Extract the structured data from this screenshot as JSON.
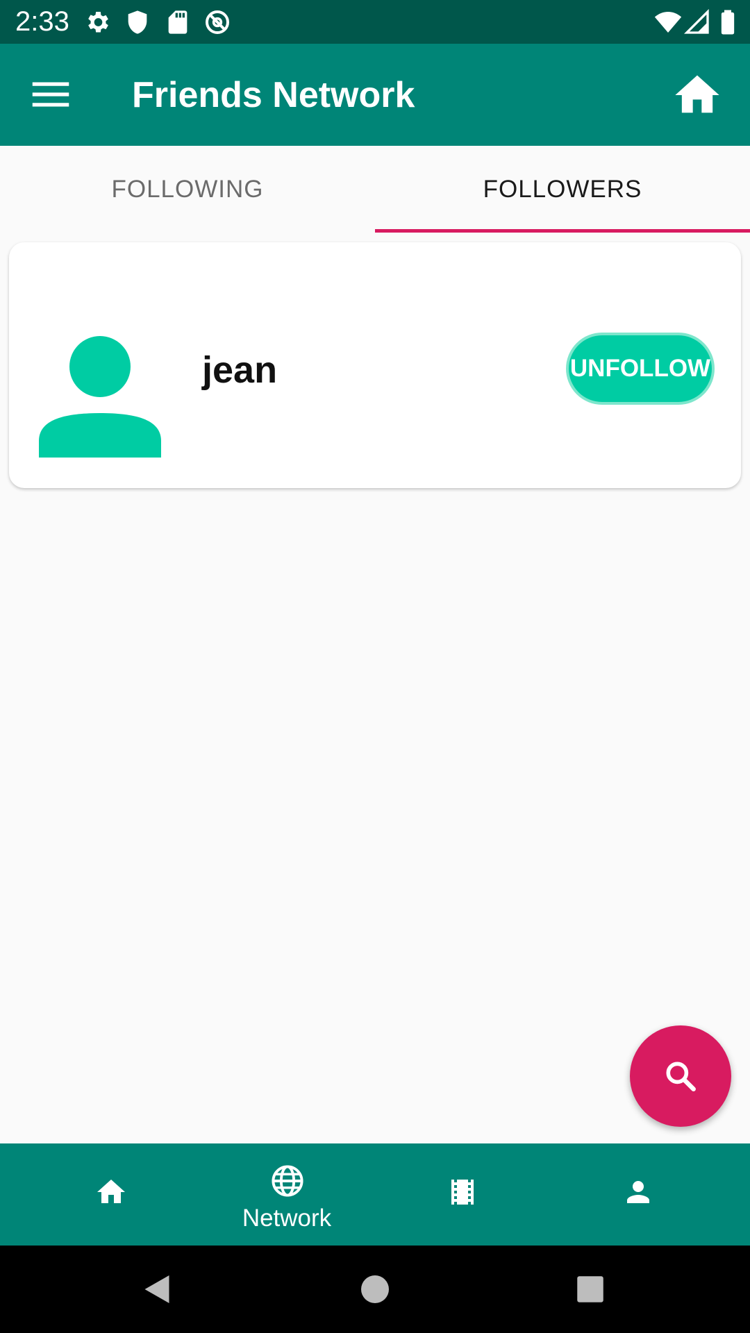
{
  "status_bar": {
    "time": "2:33",
    "left_icons": [
      "settings-icon",
      "shield-icon",
      "sd-card-icon",
      "blocked-at-icon"
    ],
    "right_icons": [
      "wifi-icon",
      "signal-icon",
      "battery-icon"
    ]
  },
  "app_bar": {
    "title": "Friends Network",
    "menu_icon": "menu-icon",
    "home_icon": "home-icon"
  },
  "tabs": [
    {
      "label": "FOLLOWING",
      "selected": false
    },
    {
      "label": "FOLLOWERS",
      "selected": true
    }
  ],
  "followers": [
    {
      "name": "jean",
      "action_label": "UNFOLLOW"
    }
  ],
  "fab": {
    "icon": "search-icon"
  },
  "bottom_nav": {
    "items": [
      {
        "icon": "home-icon",
        "label": "",
        "active": false
      },
      {
        "icon": "globe-icon",
        "label": "Network",
        "active": true
      },
      {
        "icon": "film-icon",
        "label": "",
        "active": false
      },
      {
        "icon": "person-icon",
        "label": "",
        "active": false
      }
    ]
  },
  "colors": {
    "primary": "#008577",
    "primary_dark": "#00574b",
    "accent": "#d81b60",
    "avatar": "#00cca3"
  }
}
